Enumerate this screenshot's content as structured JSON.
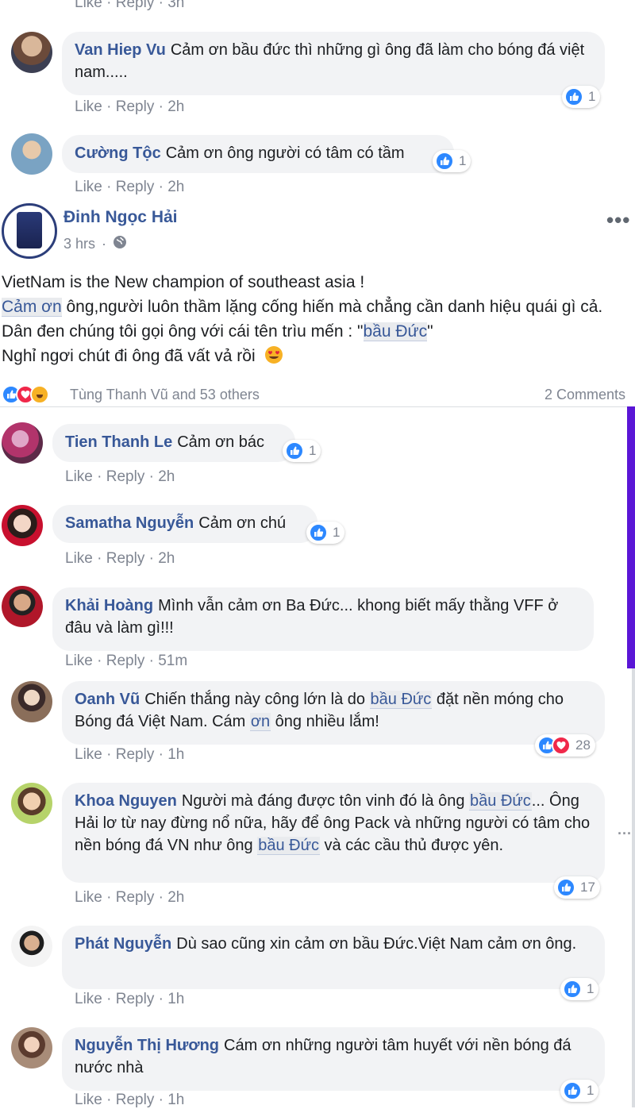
{
  "actions": {
    "like": "Like",
    "reply": "Reply",
    "sep": " · "
  },
  "comments": [
    {
      "author": "Van Hiep Vu",
      "text_parts": [
        "Cảm ơn bầu đức thì những gì ông đã làm cho bóng đá việt nam....."
      ],
      "time": "2h",
      "likes": "1"
    },
    {
      "author": "Cường Tộc",
      "text_parts": [
        "Cảm ơn ông người có tâm có tầm"
      ],
      "time": "2h",
      "likes": "1"
    },
    {
      "author": "Tien Thanh Le",
      "text_parts": [
        "Cảm ơn bác"
      ],
      "time": "2h",
      "likes": "1"
    },
    {
      "author": "Samatha Nguyễn",
      "text_parts": [
        "Cảm ơn chú"
      ],
      "time": "2h",
      "likes": "1"
    },
    {
      "author": "Khải Hoàng",
      "text_parts": [
        "Mình vẫn cảm ơn Ba Đức... khong biết mấy thằng VFF ở đâu và làm gì!!!"
      ],
      "time": "51m"
    },
    {
      "author": "Oanh Vũ",
      "text_parts": [
        "Chiến thắng này công lớn là do ",
        "bầu Đức",
        " đặt nền móng cho Bóng đá Việt Nam. Cám ",
        "ơn",
        " ông nhiều lắm!"
      ],
      "time": "1h",
      "likes": "28"
    },
    {
      "author": "Khoa Nguyen",
      "text_parts": [
        "Người mà đáng được tôn vinh đó là ông ",
        "bầu Đức",
        "... Ông Hải lơ từ nay đừng nổ nữa, hãy để ông Pack và những người có tâm cho nền bóng đá VN như ông ",
        "bầu Đức",
        " và các cầu thủ được yên."
      ],
      "time": "2h",
      "likes": "17"
    },
    {
      "author": "Phát Nguyễn",
      "text_parts": [
        "Dù sao cũng xin cảm ơn bầu Đức.Việt Nam cảm ơn ông."
      ],
      "time": "1h",
      "likes": "1"
    },
    {
      "author": "Nguyễn Thị Hương",
      "text_parts": [
        "Cám ơn những người tâm huyết với nền bóng đá nước nhà"
      ],
      "time": "1h",
      "likes": "1"
    }
  ],
  "top_actions_time": "3h",
  "post": {
    "author": "Đinh Ngọc Hải",
    "time": "3 hrs",
    "line1": "VietNam is the New champion of southeast asia !",
    "line2a": "Cảm ơn",
    "line2b": " ông,người luôn thầm lặng cống hiến mà chẳng cần danh hiệu quái gì cả. Dân đen chúng tôi gọi ông với cái tên trìu mến : \"",
    "line2tag": "bầu Đức",
    "line2c": "\"",
    "line3": "Nghỉ ngơi chút đi ông đã vất vả rồi",
    "reactors": "Tùng Thanh Vũ and 53 others",
    "comments_count": "2 Comments"
  }
}
